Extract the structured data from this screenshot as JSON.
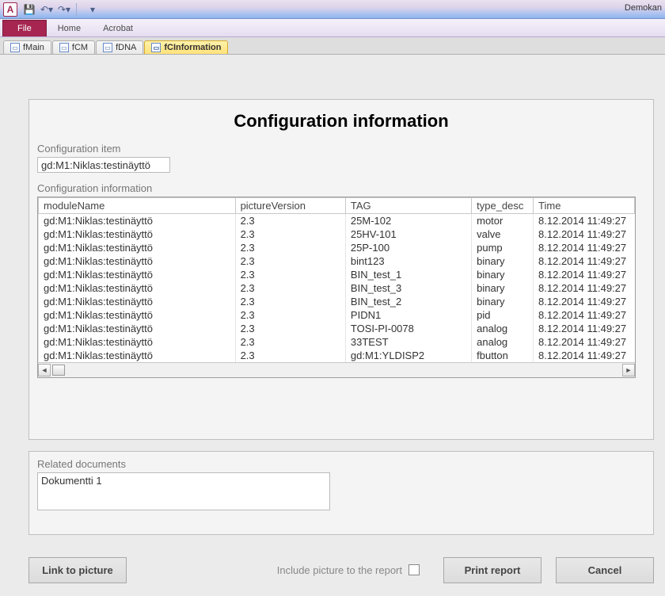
{
  "app": {
    "name": "Demokan",
    "icon_letter": "A"
  },
  "qat": {
    "undo_tip": "Undo",
    "redo_tip": "Redo"
  },
  "ribbon": {
    "file": "File",
    "tabs": [
      "Home",
      "Acrobat"
    ]
  },
  "doc_tabs": [
    {
      "label": "fMain",
      "active": false
    },
    {
      "label": "fCM",
      "active": false
    },
    {
      "label": "fDNA",
      "active": false
    },
    {
      "label": "fCInformation",
      "active": true
    }
  ],
  "form": {
    "title": "Configuration information",
    "config_item_label": "Configuration item",
    "config_item_value": "gd:M1:Niklas:testinäyttö",
    "config_info_label": "Configuration information",
    "columns": [
      "moduleName",
      "pictureVersion",
      "TAG",
      "type_desc",
      "Time"
    ],
    "rows": [
      [
        "gd:M1:Niklas:testinäyttö",
        "2.3",
        "25M-102",
        "motor",
        "8.12.2014 11:49:27"
      ],
      [
        "gd:M1:Niklas:testinäyttö",
        "2.3",
        "25HV-101",
        "valve",
        "8.12.2014 11:49:27"
      ],
      [
        "gd:M1:Niklas:testinäyttö",
        "2.3",
        "25P-100",
        "pump",
        "8.12.2014 11:49:27"
      ],
      [
        "gd:M1:Niklas:testinäyttö",
        "2.3",
        "bint123",
        "binary",
        "8.12.2014 11:49:27"
      ],
      [
        "gd:M1:Niklas:testinäyttö",
        "2.3",
        "BIN_test_1",
        "binary",
        "8.12.2014 11:49:27"
      ],
      [
        "gd:M1:Niklas:testinäyttö",
        "2.3",
        "BIN_test_3",
        "binary",
        "8.12.2014 11:49:27"
      ],
      [
        "gd:M1:Niklas:testinäyttö",
        "2.3",
        "BIN_test_2",
        "binary",
        "8.12.2014 11:49:27"
      ],
      [
        "gd:M1:Niklas:testinäyttö",
        "2.3",
        "PIDN1",
        "pid",
        "8.12.2014 11:49:27"
      ],
      [
        "gd:M1:Niklas:testinäyttö",
        "2.3",
        "TOSI-PI-0078",
        "analog",
        "8.12.2014 11:49:27"
      ],
      [
        "gd:M1:Niklas:testinäyttö",
        "2.3",
        "33TEST",
        "analog",
        "8.12.2014 11:49:27"
      ],
      [
        "gd:M1:Niklas:testinäyttö",
        "2.3",
        "gd:M1:YLDISP2",
        "fbutton",
        "8.12.2014 11:49:27"
      ]
    ],
    "related_docs_label": "Related documents",
    "related_docs": [
      "Dokumentti 1"
    ],
    "buttons": {
      "link": "Link to picture",
      "include_label": "Include picture to the report",
      "print": "Print report",
      "cancel": "Cancel"
    }
  }
}
